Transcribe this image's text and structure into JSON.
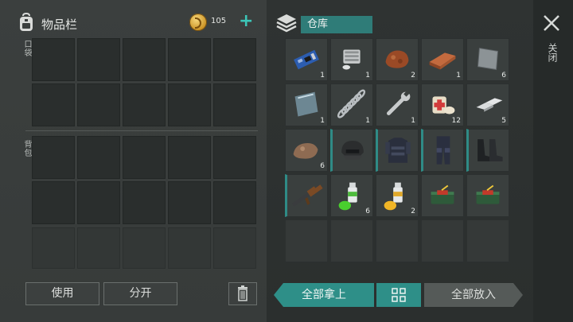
{
  "header": {
    "title": "物品栏",
    "coins": "105",
    "add_label": "+"
  },
  "sections": {
    "pocket_label": "口袋",
    "backpack_label": "背包"
  },
  "buttons": {
    "use": "使用",
    "split": "分开",
    "take_all": "全部拿上",
    "put_all": "全部放入"
  },
  "storage": {
    "title": "仓库",
    "items": [
      {
        "icon": "circuit-board-icon",
        "qty": "1"
      },
      {
        "icon": "engine-part-icon",
        "qty": "1"
      },
      {
        "icon": "clay-lump-icon",
        "qty": "2"
      },
      {
        "icon": "copper-ingot-icon",
        "qty": "1"
      },
      {
        "icon": "metal-plate-icon",
        "qty": "6"
      },
      {
        "icon": "glass-pane-icon",
        "qty": "1"
      },
      {
        "icon": "spring-icon",
        "qty": "1"
      },
      {
        "icon": "wrench-icon",
        "qty": "1"
      },
      {
        "icon": "bandage-icon",
        "qty": "12"
      },
      {
        "icon": "silver-bars-icon",
        "qty": "5"
      },
      {
        "icon": "ore-rock-icon",
        "qty": "6"
      },
      {
        "icon": "helmet-icon",
        "qty": ""
      },
      {
        "icon": "armor-vest-icon",
        "qty": ""
      },
      {
        "icon": "armor-pants-icon",
        "qty": ""
      },
      {
        "icon": "boots-icon",
        "qty": ""
      },
      {
        "icon": "assault-rifle-icon",
        "qty": ""
      },
      {
        "icon": "green-spray-can-icon",
        "qty": "6"
      },
      {
        "icon": "yellow-spray-can-icon",
        "qty": "2"
      },
      {
        "icon": "explosive-charge-icon",
        "qty": ""
      },
      {
        "icon": "explosive-charge-icon",
        "qty": ""
      }
    ]
  },
  "side": {
    "close_label": "关闭"
  },
  "colors": {
    "accent": "#2e8f88",
    "coin": "#d9a232"
  }
}
